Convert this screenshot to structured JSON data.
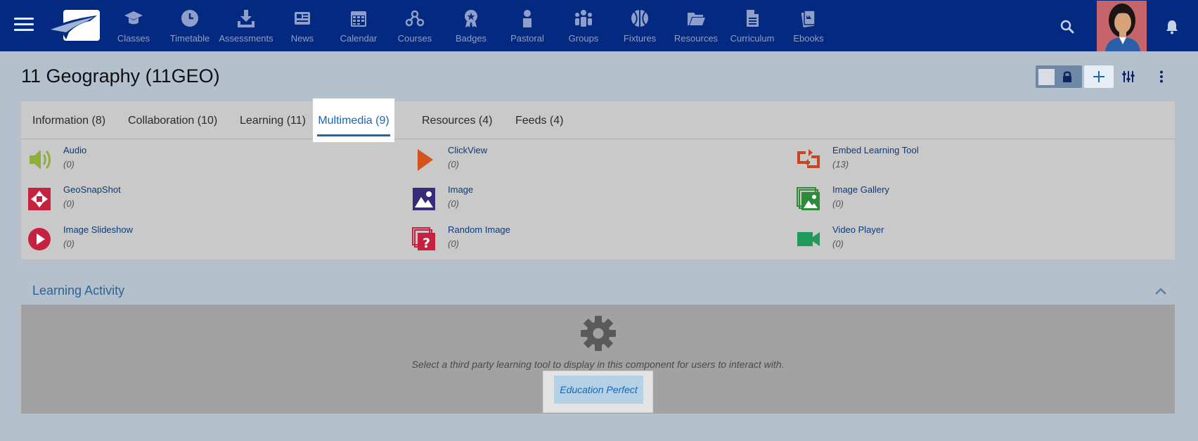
{
  "topbar": {
    "nav": [
      {
        "label": "Classes",
        "icon": "graduation-cap-icon"
      },
      {
        "label": "Timetable",
        "icon": "clock-icon"
      },
      {
        "label": "Assessments",
        "icon": "download-tray-icon"
      },
      {
        "label": "News",
        "icon": "newspaper-icon"
      },
      {
        "label": "Calendar",
        "icon": "calendar-icon"
      },
      {
        "label": "Courses",
        "icon": "network-icon"
      },
      {
        "label": "Badges",
        "icon": "badge-icon"
      },
      {
        "label": "Pastoral",
        "icon": "person-icon"
      },
      {
        "label": "Groups",
        "icon": "group-icon"
      },
      {
        "label": "Fixtures",
        "icon": "basketball-icon"
      },
      {
        "label": "Resources",
        "icon": "folder-open-icon"
      },
      {
        "label": "Curriculum",
        "icon": "document-icon"
      },
      {
        "label": "Ebooks",
        "icon": "ebook-icon"
      }
    ]
  },
  "page": {
    "title": "11 Geography (11GEO)"
  },
  "tabs": [
    {
      "label": "Information (8)"
    },
    {
      "label": "Collaboration (10)"
    },
    {
      "label": "Learning (11)"
    },
    {
      "label": "Multimedia (9)",
      "active": true
    },
    {
      "label": "Resources (4)"
    },
    {
      "label": "Feeds (4)"
    }
  ],
  "multimedia_items": [
    {
      "name": "Audio",
      "count": "(0)",
      "icon": "speaker-icon",
      "color": "#8db03a"
    },
    {
      "name": "ClickView",
      "count": "(0)",
      "icon": "play-triangle-icon",
      "color": "#d2531e"
    },
    {
      "name": "Embed Learning Tool",
      "count": "(13)",
      "icon": "embed-icon",
      "color": "#c8451f"
    },
    {
      "name": "GeoSnapShot",
      "count": "(0)",
      "icon": "aperture-icon",
      "color": "#c8213f"
    },
    {
      "name": "Image",
      "count": "(0)",
      "icon": "image-icon",
      "color": "#3a2b78"
    },
    {
      "name": "Image Gallery",
      "count": "(0)",
      "icon": "image-gallery-icon",
      "color": "#2e8b3a"
    },
    {
      "name": "Image Slideshow",
      "count": "(0)",
      "icon": "slideshow-play-icon",
      "color": "#c8213f"
    },
    {
      "name": "Random Image",
      "count": "(0)",
      "icon": "random-image-icon",
      "color": "#c8213f"
    },
    {
      "name": "Video Player",
      "count": "(0)",
      "icon": "video-camera-icon",
      "color": "#1f9a5a"
    }
  ],
  "learning_activity": {
    "title": "Learning Activity",
    "message": "Select a third party learning tool to display in this component for users to interact with.",
    "button_label": "Education Perfect"
  },
  "colors": {
    "topbar": "#032a80",
    "accent": "#1767b4",
    "background": "#b4c1cc"
  }
}
